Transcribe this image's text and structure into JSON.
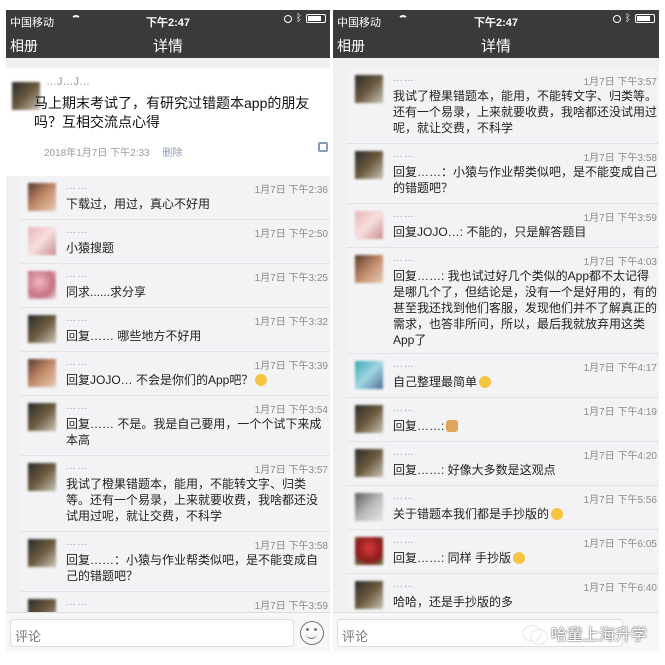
{
  "left": {
    "status": {
      "carrier": "中国移动",
      "time": "下午2:47"
    },
    "nav": {
      "back": "相册",
      "title": "详情"
    },
    "post": {
      "author": "…J…J…",
      "text": "马上期末考试了，有研究过错题本app的朋友吗？互相交流点心得",
      "date": "2018年1月7日 下午2:33",
      "delete": "删除"
    },
    "comments": [
      {
        "name": "……",
        "time": "1月7日 下午2:36",
        "text": "下载过，用过，真心不好用"
      },
      {
        "name": "……",
        "time": "1月7日 下午2:50",
        "text": "小猿搜题"
      },
      {
        "name": "……",
        "time": "1月7日 下午3:25",
        "text": "同求......求分享"
      },
      {
        "name": "……",
        "time": "1月7日 下午3:32",
        "text": "回复…… 哪些地方不好用"
      },
      {
        "name": "……",
        "time": "1月7日 下午3:39",
        "text": "回复JOJO… 不会是你们的App吧？"
      },
      {
        "name": "……",
        "time": "1月7日 下午3:54",
        "text": "回复…… 不是。我是自己要用，一个个试下来成本高"
      },
      {
        "name": "……",
        "time": "1月7日 下午3:57",
        "text": "我试了橙果错题本，能用，不能转文字、归类等。还有一个易录，上来就要收费，我啥都还没试用过呢，就让交费，不科学"
      },
      {
        "name": "……",
        "time": "1月7日 下午3:58",
        "text": "回复……：小猿与作业帮类似吧，是不能变成自己的错题吧？"
      },
      {
        "name": "……",
        "time": "1月7日 下午3:59",
        "text": ""
      }
    ],
    "input_placeholder": "评论"
  },
  "right": {
    "status": {
      "carrier": "中国移动",
      "time": "下午2:47"
    },
    "nav": {
      "back": "相册",
      "title": "详情"
    },
    "comments": [
      {
        "name": "……",
        "time": "1月7日 下午3:57",
        "text": "我试了橙果错题本，能用，不能转文字、归类等。还有一个易录，上来就要收费，我啥都还没试用过呢，就让交费，不科学"
      },
      {
        "name": "……",
        "time": "1月7日 下午3:58",
        "text": "回复……：小猿与作业帮类似吧，是不能变成自己的错题吧？"
      },
      {
        "name": "……",
        "time": "1月7日 下午3:59",
        "text": "回复JOJO…: 不能的，只是解答题目"
      },
      {
        "name": "……",
        "time": "1月7日 下午4:03",
        "text": "回复……: 我也试过好几个类似的App都不太记得是哪几个了，但结论是，没有一个是好用的，有的甚至我还找到他们客服，发现他们并不了解真正的需求，也答非所问，所以，最后我就放弃用这类App了"
      },
      {
        "name": "……",
        "time": "1月7日 下午4:17",
        "text": "自己整理最简单"
      },
      {
        "name": "……",
        "time": "1月7日 下午4:19",
        "text": "回复……:"
      },
      {
        "name": "……",
        "time": "1月7日 下午4:20",
        "text": "回复……: 好像大多数是这观点"
      },
      {
        "name": "……",
        "time": "1月7日 下午5:56",
        "text": "关于错题本我们都是手抄版的"
      },
      {
        "name": "……",
        "time": "1月7日 下午6:05",
        "text": "回复……: 同样 手抄版"
      },
      {
        "name": "……",
        "time": "1月7日 下午6:40",
        "text": "哈哈，还是手抄版的多"
      }
    ],
    "input_placeholder": "评论"
  },
  "watermark": "哈童上海升学",
  "icons": {
    "wifi": "wifi-icon",
    "alarm": "alarm-icon",
    "bluetooth": "bluetooth-icon",
    "battery": "battery-icon",
    "emoji": "emoji-smiley-icon",
    "more": "more-options-icon",
    "wechat": "wechat-logo-icon"
  },
  "colors": {
    "bar": "#3a3a3c",
    "name": "#8a9bb5",
    "bg": "#f0f0f2"
  }
}
